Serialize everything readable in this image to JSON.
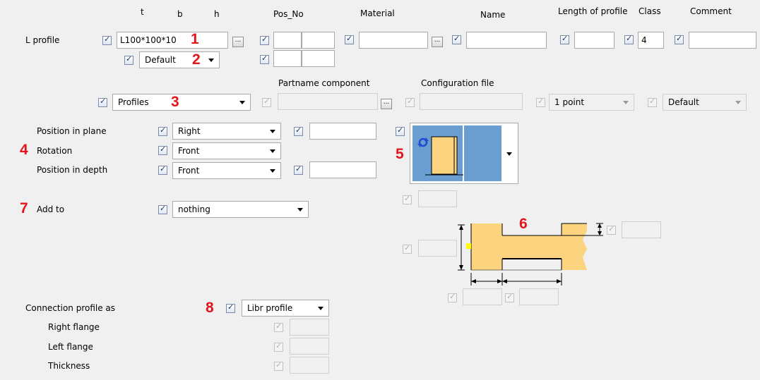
{
  "headers": {
    "t": "t",
    "b": "b",
    "h": "h",
    "pos_no": "Pos_No",
    "material": "Material",
    "name": "Name",
    "length": "Length of profile",
    "class": "Class",
    "comment": "Comment",
    "partname_component": "Partname component",
    "configuration_file": "Configuration file"
  },
  "row_l_profile": {
    "label": "L profile",
    "profile_value": "L100*100*10",
    "class_value": "4",
    "ellipsis": "...",
    "default_value": "Default"
  },
  "row_profiles": {
    "profiles_value": "Profiles",
    "point_value": "1 point",
    "default_value": "Default"
  },
  "position": {
    "in_plane_label": "Position in plane",
    "in_plane_value": "Right",
    "rotation_label": "Rotation",
    "rotation_value": "Front",
    "depth_label": "Position in depth",
    "depth_value": "Front"
  },
  "add_to": {
    "label": "Add to",
    "value": "nothing"
  },
  "connection": {
    "label": "Connection profile as",
    "value": "Libr profile",
    "right_flange": "Right flange",
    "left_flange": "Left flange",
    "thickness": "Thickness"
  },
  "markers": [
    "1",
    "2",
    "3",
    "4",
    "5",
    "6",
    "7",
    "8"
  ],
  "colors": {
    "profile_fill": "#fcd37f",
    "preview_blue": "#6a9dd0",
    "marker_red": "#e3141c",
    "handle_yellow": "#ffff00"
  }
}
